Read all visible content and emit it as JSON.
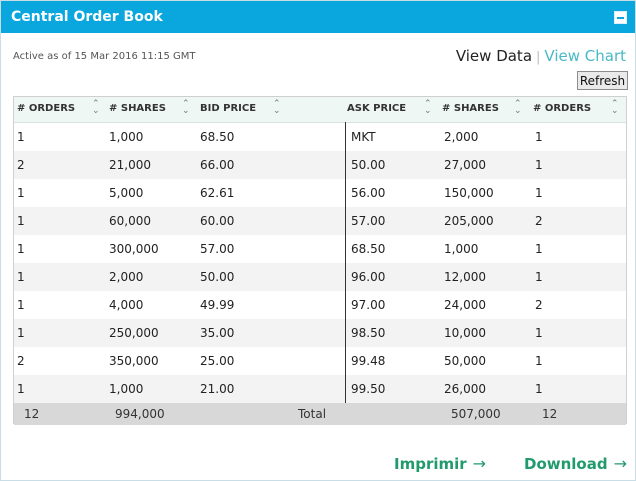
{
  "window": {
    "title": "Central Order Book"
  },
  "meta": {
    "active": "Active as of 15 Mar 2016 11:15 GMT"
  },
  "views": {
    "data": "View Data",
    "separator": "|",
    "chart": "View Chart"
  },
  "actions": {
    "refresh": "Refresh",
    "print": "Imprimir",
    "download": "Download"
  },
  "table": {
    "columns": [
      "# ORDERS",
      "# SHARES",
      "BID PRICE",
      "ASK PRICE",
      "# SHARES",
      "# ORDERS"
    ],
    "rows": [
      {
        "bid_orders": "1",
        "bid_shares": "1,000",
        "bid_price": "68.50",
        "ask_price": "MKT",
        "ask_shares": "2,000",
        "ask_orders": "1"
      },
      {
        "bid_orders": "2",
        "bid_shares": "21,000",
        "bid_price": "66.00",
        "ask_price": "50.00",
        "ask_shares": "27,000",
        "ask_orders": "1"
      },
      {
        "bid_orders": "1",
        "bid_shares": "5,000",
        "bid_price": "62.61",
        "ask_price": "56.00",
        "ask_shares": "150,000",
        "ask_orders": "1"
      },
      {
        "bid_orders": "1",
        "bid_shares": "60,000",
        "bid_price": "60.00",
        "ask_price": "57.00",
        "ask_shares": "205,000",
        "ask_orders": "2"
      },
      {
        "bid_orders": "1",
        "bid_shares": "300,000",
        "bid_price": "57.00",
        "ask_price": "68.50",
        "ask_shares": "1,000",
        "ask_orders": "1"
      },
      {
        "bid_orders": "1",
        "bid_shares": "2,000",
        "bid_price": "50.00",
        "ask_price": "96.00",
        "ask_shares": "12,000",
        "ask_orders": "1"
      },
      {
        "bid_orders": "1",
        "bid_shares": "4,000",
        "bid_price": "49.99",
        "ask_price": "97.00",
        "ask_shares": "24,000",
        "ask_orders": "2"
      },
      {
        "bid_orders": "1",
        "bid_shares": "250,000",
        "bid_price": "35.00",
        "ask_price": "98.50",
        "ask_shares": "10,000",
        "ask_orders": "1"
      },
      {
        "bid_orders": "2",
        "bid_shares": "350,000",
        "bid_price": "25.00",
        "ask_price": "99.48",
        "ask_shares": "50,000",
        "ask_orders": "1"
      },
      {
        "bid_orders": "1",
        "bid_shares": "1,000",
        "bid_price": "21.00",
        "ask_price": "99.50",
        "ask_shares": "26,000",
        "ask_orders": "1"
      }
    ],
    "total": {
      "bid_orders": "12",
      "bid_shares": "994,000",
      "label": "Total",
      "ask_shares": "507,000",
      "ask_orders": "12"
    }
  },
  "colors": {
    "title_bar": "#0aa7de",
    "accent_link": "#49b9c5",
    "action_green": "#219a6e"
  }
}
